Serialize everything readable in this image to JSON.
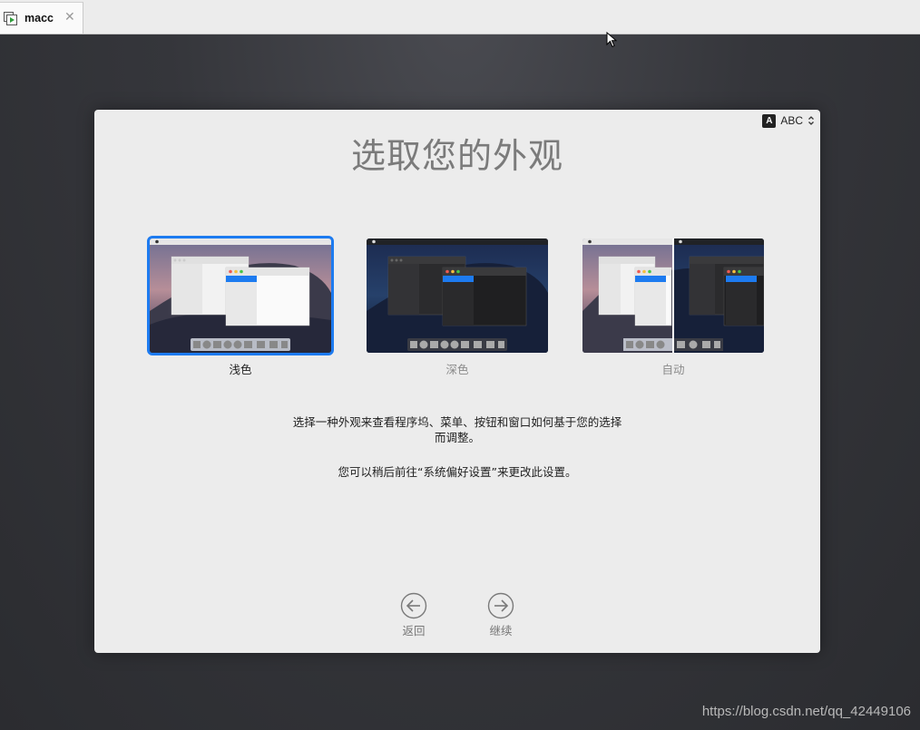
{
  "tab": {
    "label": "macc",
    "close_glyph": "✕",
    "icon": "vm-play-icon"
  },
  "input_menu": {
    "badge": "A",
    "label": "ABC"
  },
  "title": "选取您的外观",
  "options": [
    {
      "label": "浅色",
      "selected": true
    },
    {
      "label": "深色",
      "selected": false
    },
    {
      "label": "自动",
      "selected": false
    }
  ],
  "description": {
    "line1": "选择一种外观来查看程序坞、菜单、按钮和窗口如何基于您的选择",
    "line2": "而调整。",
    "note": "您可以稍后前往“系统偏好设置”来更改此设置。"
  },
  "nav": {
    "back_label": "返回",
    "continue_label": "继续"
  },
  "watermark": "https://blog.csdn.net/qq_42449106",
  "colors": {
    "accent": "#1d7bf0",
    "panel": "#ececec"
  }
}
